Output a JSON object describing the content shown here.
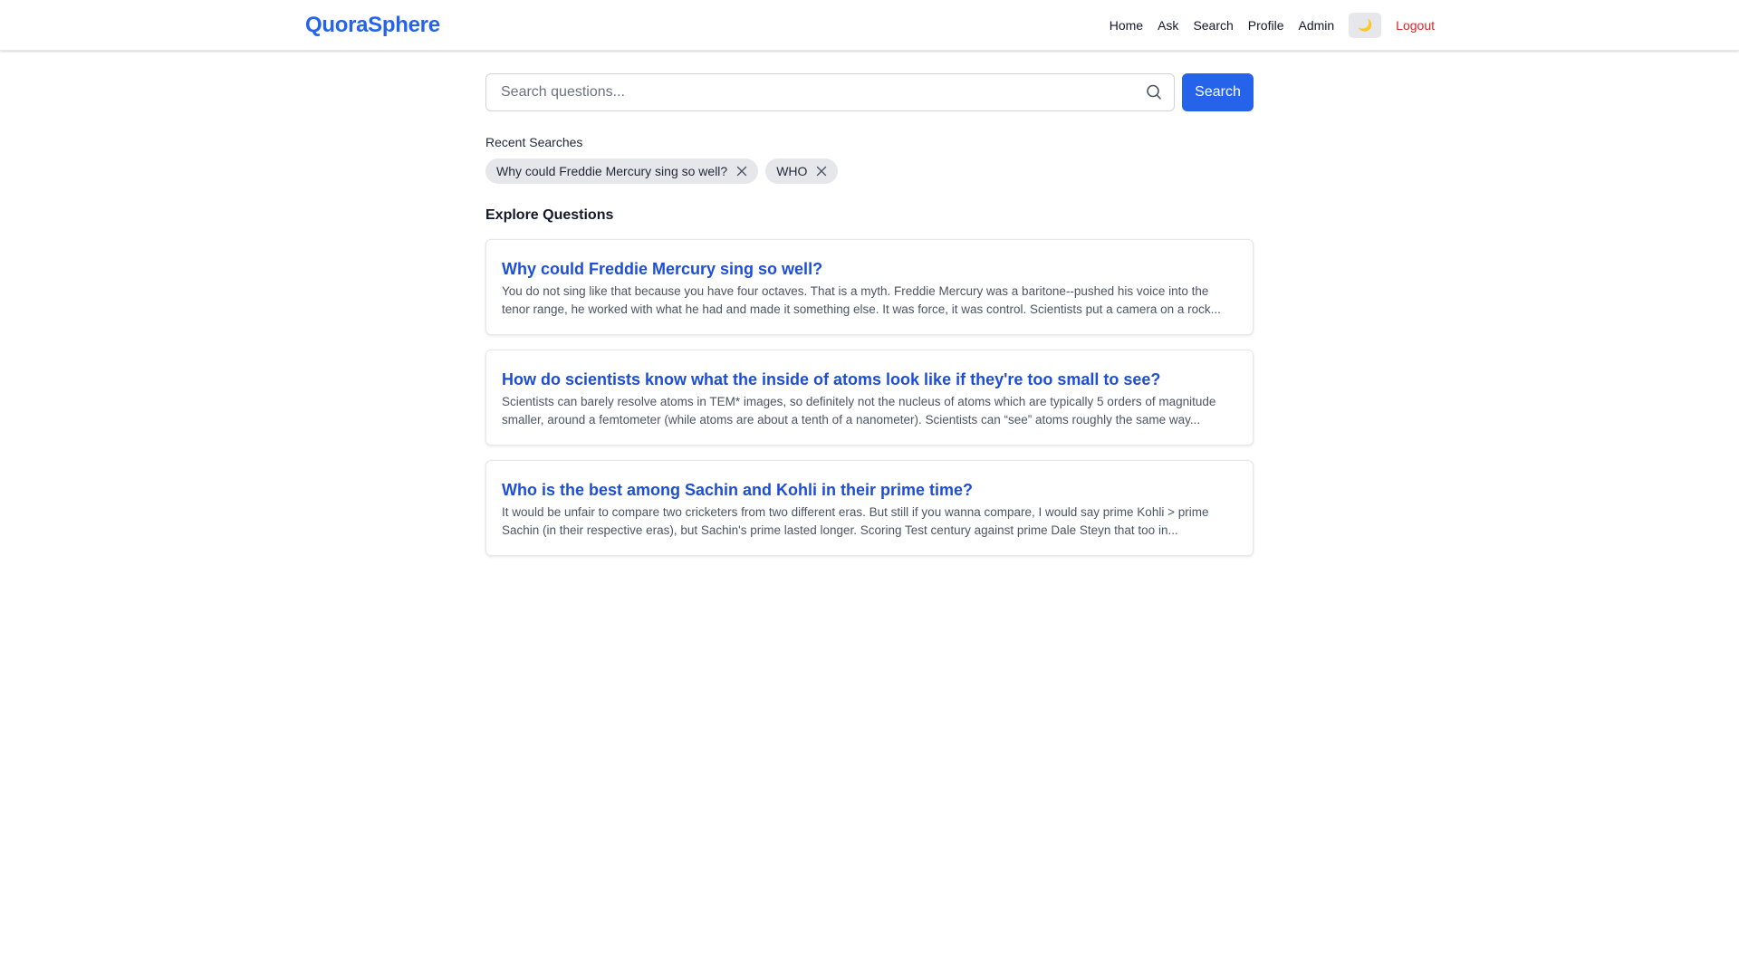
{
  "navbar": {
    "brand": "QuoraSphere",
    "links": [
      "Home",
      "Ask",
      "Search",
      "Profile",
      "Admin"
    ],
    "theme_toggle_icon": "🌙",
    "logout": "Logout"
  },
  "search": {
    "placeholder": "Search questions...",
    "value": "",
    "button_label": "Search"
  },
  "recent": {
    "title": "Recent Searches",
    "items": [
      "Why could Freddie Mercury sing so well?",
      "WHO"
    ]
  },
  "explore": {
    "title": "Explore Questions",
    "questions": [
      {
        "title": "Why could Freddie Mercury sing so well?",
        "excerpt": "You do not sing like that because you have four octaves. That is a myth. Freddie Mercury was a baritone--pushed his voice into the tenor range, he worked with what he had and made it something else. It was force, it was control. Scientists put a camera on a rock..."
      },
      {
        "title": "How do scientists know what the inside of atoms look like if they're too small to see?",
        "excerpt": "Scientists can barely resolve atoms in TEM* images, so definitely not the nucleus of atoms which are typically 5 orders of magnitude smaller, around a femtometer (while atoms are about a tenth of a nanometer). Scientists can “see” atoms roughly the same way..."
      },
      {
        "title": "Who is the best among Sachin and Kohli in their prime time?",
        "excerpt": "It would be unfair to compare two cricketers from two different eras. But still if you wanna compare, I would say prime Kohli > prime Sachin (in their respective eras), but Sachin's prime lasted longer. Scoring Test century against prime Dale Steyn that too in..."
      }
    ]
  },
  "colors": {
    "accent": "#2563eb",
    "link": "#1d4ed8",
    "logout": "#dc2626"
  }
}
